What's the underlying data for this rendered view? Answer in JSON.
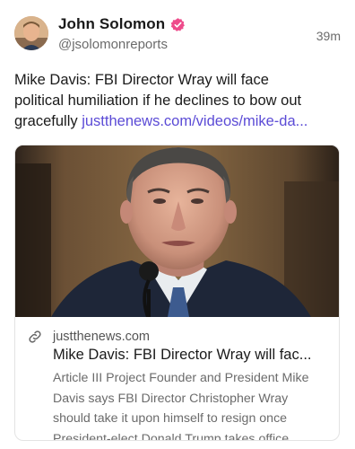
{
  "post": {
    "author": {
      "display_name": "John Solomon",
      "handle": "@jsolomonreports",
      "verified_icon": "verified-badge-icon",
      "avatar": "avatar"
    },
    "timestamp": "39m",
    "text_lines": [
      "Mike Davis: FBI Director Wray will face",
      "political humiliation if he declines to bow out"
    ],
    "text_last_prefix": "gracefully ",
    "link_text": "justthenews.com/videos/mike-da..."
  },
  "card": {
    "image": "man-in-suit-at-microphone",
    "link_icon": "link-icon",
    "domain": "justthenews.com",
    "title": "Mike Davis: FBI Director Wray will fac...",
    "description_lines": [
      "Article III Project Founder and President Mike",
      "Davis says FBI Director Christopher Wray",
      "should take it upon himself to resign once",
      "President-elect Donald Trump takes office. ..."
    ]
  },
  "colors": {
    "link": "#5b4bd6",
    "verified": "#ee4b8b",
    "muted_text": "#6b6b6b"
  }
}
